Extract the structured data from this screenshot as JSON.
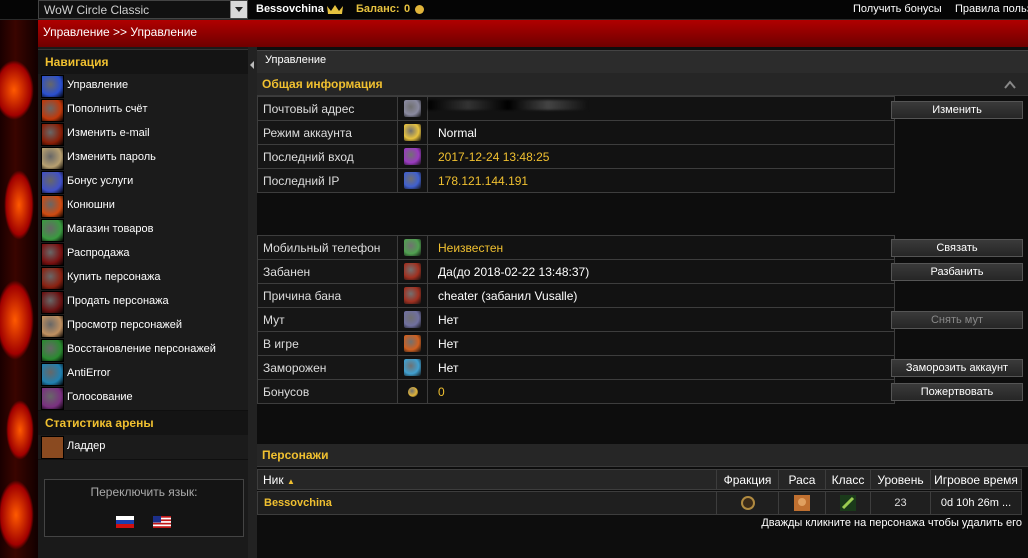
{
  "topbar": {
    "server": "WoW Circle Classic",
    "username": "Bessovchina",
    "balance_label": "Баланс:",
    "balance_value": "0",
    "bonus_link": "Получить бонусы",
    "rules_link": "Правила польз"
  },
  "breadcrumb": "Управление >> Управление",
  "sidebar": {
    "nav_title": "Навигация",
    "items": [
      {
        "label": "Управление",
        "icon": "blue-rune-icon",
        "color": "#2a4fd0"
      },
      {
        "label": "Пополнить счёт",
        "icon": "fire-icon",
        "color": "#c0380a"
      },
      {
        "label": "Изменить e-mail",
        "icon": "flame-orb-icon",
        "color": "#8a1d05"
      },
      {
        "label": "Изменить пароль",
        "icon": "face-icon",
        "color": "#b8a070"
      },
      {
        "label": "Бонус услуги",
        "icon": "lightning-icon",
        "color": "#4050c8"
      },
      {
        "label": "Конюшни",
        "icon": "flame-icon",
        "color": "#d04a10"
      },
      {
        "label": "Магазин товаров",
        "icon": "green-orb-icon",
        "color": "#3a9a40"
      },
      {
        "label": "Распродажа",
        "icon": "demon-icon",
        "color": "#7a1010"
      },
      {
        "label": "Купить персонажа",
        "icon": "demon-face-icon",
        "color": "#8a2010"
      },
      {
        "label": "Продать персонажа",
        "icon": "skull-icon",
        "color": "#6a1010"
      },
      {
        "label": "Просмотр персонажей",
        "icon": "character-icon",
        "color": "#c09060"
      },
      {
        "label": "Восстановление персонажей",
        "icon": "nature-icon",
        "color": "#2a8a30"
      },
      {
        "label": "AntiError",
        "icon": "swirl-icon",
        "color": "#2080b0"
      },
      {
        "label": "Голосование",
        "icon": "cross-icon",
        "color": "#7a3080"
      }
    ],
    "arena_title": "Статистика арены",
    "arena_items": [
      {
        "label": "Ладдер",
        "icon": "fist-icon",
        "color": "#8a4a20"
      }
    ],
    "lang_label": "Переключить язык:"
  },
  "main": {
    "title": "Управление",
    "general_title": "Общая информация",
    "general": [
      {
        "key": "Почтовый адрес",
        "value": "",
        "icon": "mail-shield-icon"
      },
      {
        "key": "Режим аккаунта",
        "value": "Normal",
        "icon": "star-icon"
      },
      {
        "key": "Последний вход",
        "value": "2017-12-24 13:48:25",
        "icon": "purple-rune-icon"
      },
      {
        "key": "Последний IP",
        "value": "178.121.144.191",
        "icon": "network-icon"
      }
    ],
    "change_button": "Изменить",
    "status": [
      {
        "key": "Мобильный телефон",
        "value": "Неизвестен",
        "icon": "phone-icon"
      },
      {
        "key": "Забанен",
        "value": "Да(до 2018-02-22 13:48:37)",
        "icon": "ban-hand-icon"
      },
      {
        "key": "Причина бана",
        "value": "cheater (забанил Vusalle)",
        "icon": "ban-hand-icon"
      },
      {
        "key": "Мут",
        "value": "Нет",
        "icon": "mute-icon"
      },
      {
        "key": "В игре",
        "value": "Нет",
        "icon": "ingame-icon"
      },
      {
        "key": "Заморожен",
        "value": "Нет",
        "icon": "frost-icon"
      },
      {
        "key": "Бонусов",
        "value": "0",
        "icon": "coin-icon"
      }
    ],
    "buttons": {
      "link": "Связать",
      "unban": "Разбанить",
      "unmute": "Снять мут",
      "freeze": "Заморозить аккаунт",
      "donate": "Пожертвовать"
    },
    "characters_title": "Персонажи",
    "char_columns": [
      "Ник",
      "Фракция",
      "Раса",
      "Класс",
      "Уровень",
      "Игровое время"
    ],
    "characters": [
      {
        "name": "Bessovchina",
        "level": "23",
        "time": "0d 10h 26m ..."
      }
    ],
    "hint": "Дважды кликните на персонажа чтобы удалить его"
  }
}
